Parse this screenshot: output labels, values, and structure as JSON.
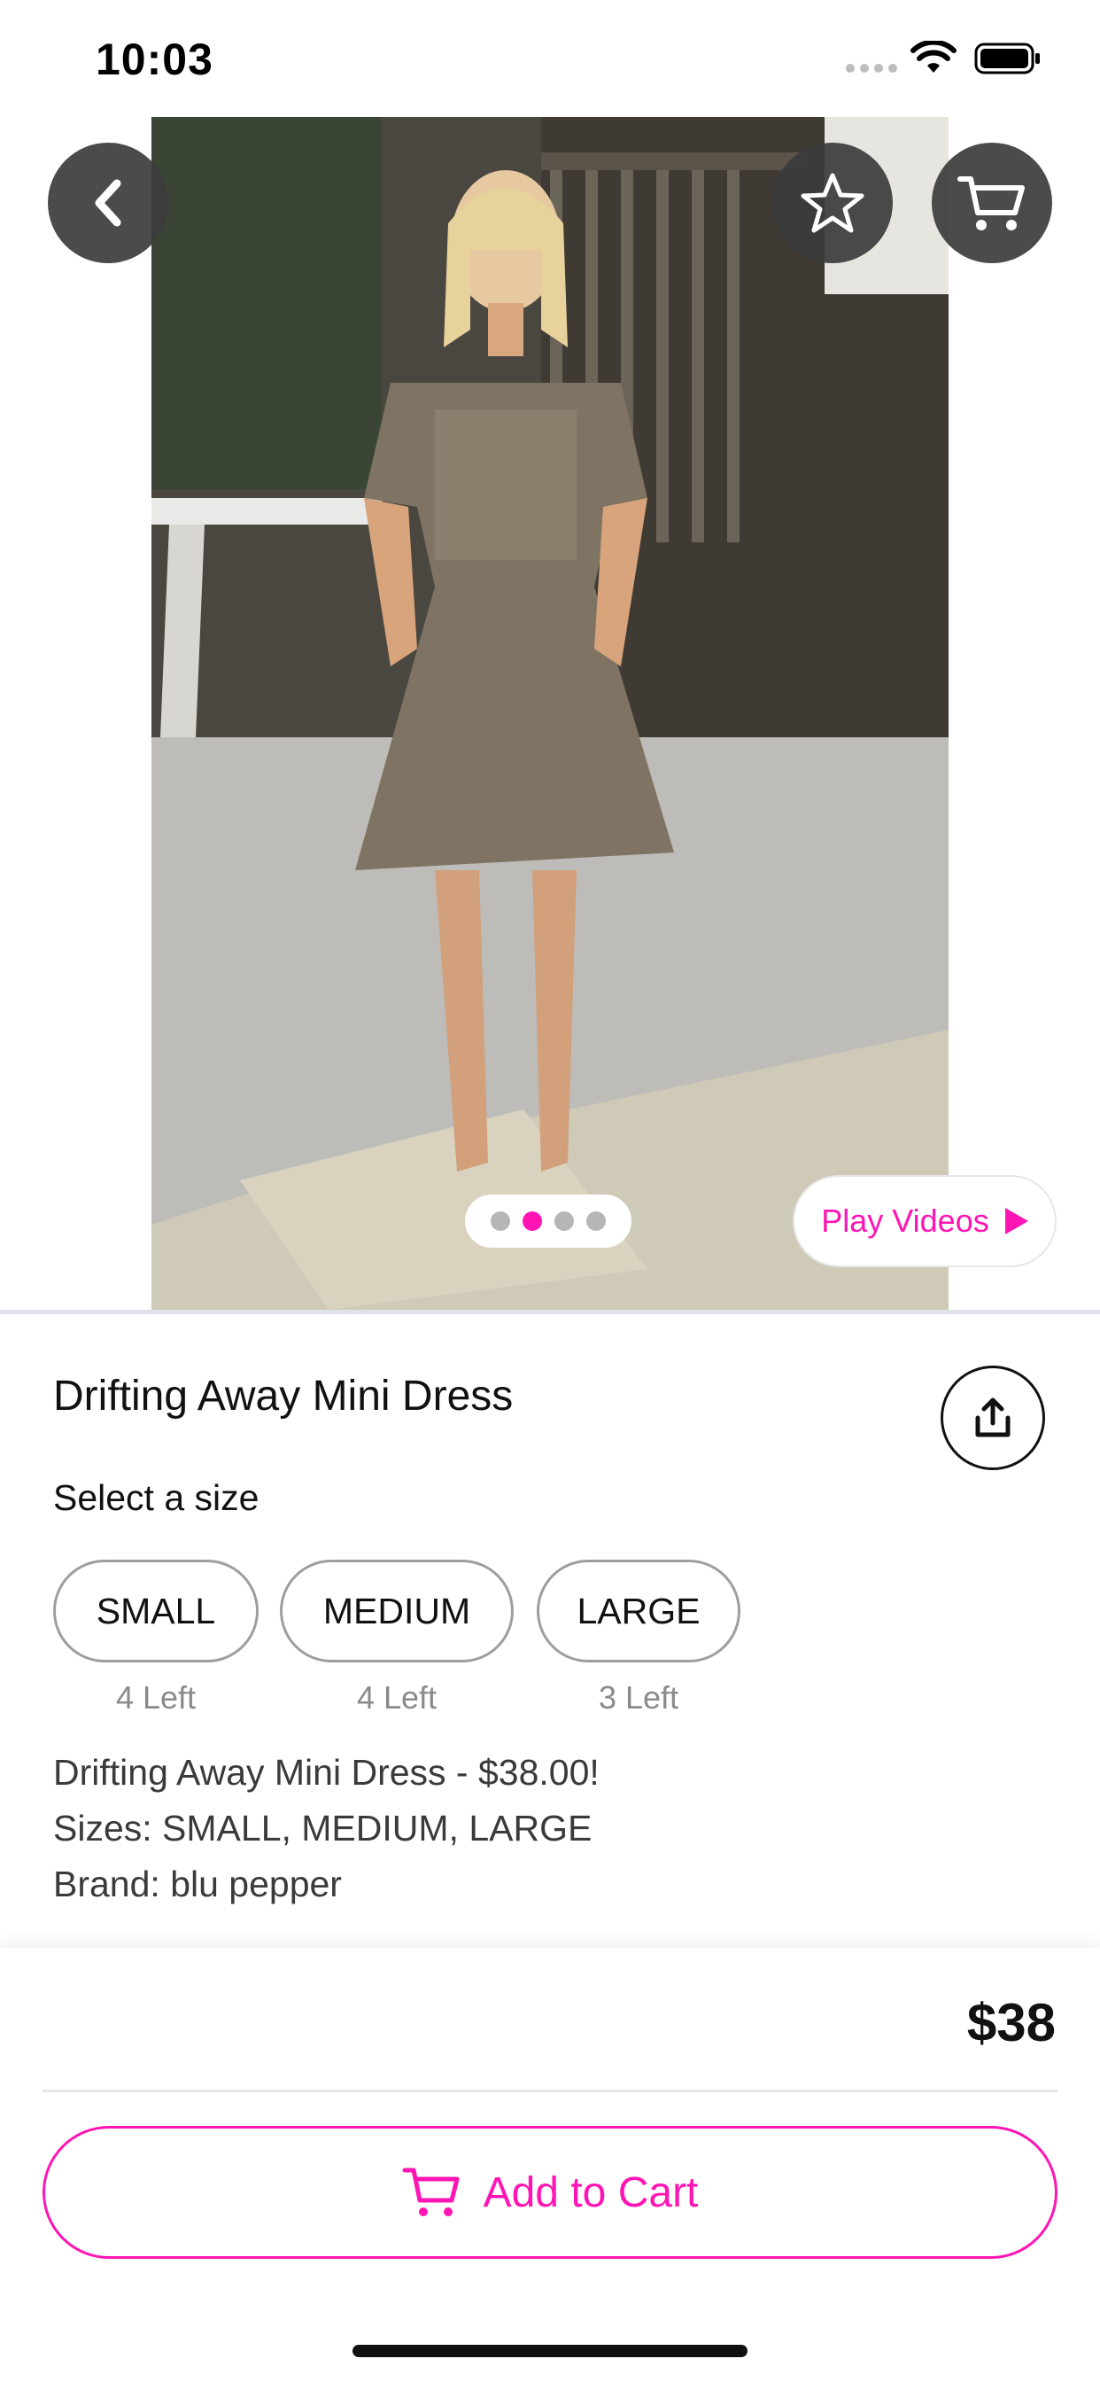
{
  "status_bar": {
    "time": "10:03"
  },
  "product": {
    "title": "Drifting Away Mini Dress",
    "image_carousel": {
      "total_images": 4,
      "active_index": 1
    },
    "play_videos_label": "Play Videos",
    "select_size_label": "Select a size",
    "sizes": [
      {
        "label": "SMALL",
        "stock": "4 Left"
      },
      {
        "label": "MEDIUM",
        "stock": "4 Left"
      },
      {
        "label": "LARGE",
        "stock": "3 Left"
      }
    ],
    "description": [
      "Drifting Away Mini Dress - $38.00!",
      "Sizes: SMALL, MEDIUM, LARGE",
      "Brand: blu pepper"
    ]
  },
  "checkout": {
    "price": "$38",
    "add_to_cart_label": "Add to Cart"
  },
  "colors": {
    "accent": "#ff14b4",
    "icon_button_bg": "#3c3c3c",
    "divider": "#dde3e8"
  },
  "icons": {
    "back": "chevron-left-icon",
    "favorite": "star-icon",
    "cart": "cart-icon",
    "share": "share-icon",
    "play": "play-icon"
  }
}
